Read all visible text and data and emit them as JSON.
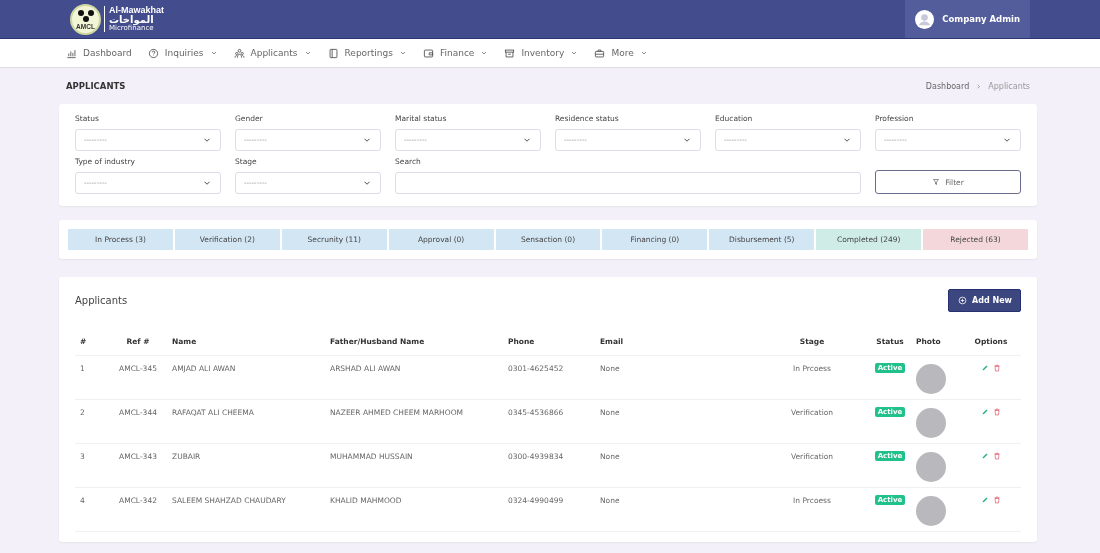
{
  "header": {
    "logo": {
      "title": "Al-Mawakhat",
      "arabic": "المواخات",
      "tagline": "Microfinance",
      "badge": "AMCL"
    },
    "user": "Company Admin"
  },
  "nav": [
    {
      "label": "Dashboard",
      "dropdown": false
    },
    {
      "label": "Inquiries",
      "dropdown": true
    },
    {
      "label": "Applicants",
      "dropdown": true
    },
    {
      "label": "Reportings",
      "dropdown": true
    },
    {
      "label": "Finance",
      "dropdown": true
    },
    {
      "label": "Inventory",
      "dropdown": true
    },
    {
      "label": "More",
      "dropdown": true
    }
  ],
  "page": {
    "title": "APPLICANTS",
    "breadcrumb": [
      "Dashboard",
      "Applicants"
    ]
  },
  "filters": [
    {
      "label": "Status",
      "kind": "select",
      "value": "---------"
    },
    {
      "label": "Gender",
      "kind": "select",
      "value": "---------"
    },
    {
      "label": "Marital status",
      "kind": "select",
      "value": "---------"
    },
    {
      "label": "Residence status",
      "kind": "select",
      "value": "---------"
    },
    {
      "label": "Education",
      "kind": "select",
      "value": "---------"
    },
    {
      "label": "Profession",
      "kind": "select",
      "value": "---------"
    },
    {
      "label": "Type of industry",
      "kind": "select",
      "value": "---------"
    },
    {
      "label": "Stage",
      "kind": "select",
      "value": "---------"
    },
    {
      "label": "Search",
      "kind": "text"
    }
  ],
  "filter_button": "Filter",
  "stages": [
    {
      "label": "In Process (3)",
      "color": "#d3e6f4"
    },
    {
      "label": "Verification (2)",
      "color": "#d3e6f4"
    },
    {
      "label": "Secrunity (11)",
      "color": "#d3e6f4"
    },
    {
      "label": "Approval (0)",
      "color": "#d3e6f4"
    },
    {
      "label": "Sensaction (0)",
      "color": "#d3e6f4"
    },
    {
      "label": "Financing (0)",
      "color": "#d3e6f4"
    },
    {
      "label": "Disbursement (5)",
      "color": "#d3e6f4"
    },
    {
      "label": "Completed (249)",
      "color": "#cfece6"
    },
    {
      "label": "Rejected (63)",
      "color": "#f3d7da"
    }
  ],
  "table": {
    "title": "Applicants",
    "add_button": "Add New",
    "columns": [
      "#",
      "Ref #",
      "Name",
      "Father/Husband Name",
      "Phone",
      "Email",
      "Stage",
      "Status",
      "Photo",
      "Options"
    ],
    "rows": [
      {
        "no": "1",
        "ref": "AMCL-345",
        "name": "AMJAD ALI AWAN",
        "father": "ARSHAD ALI AWAN",
        "phone": "0301-4625452",
        "email": "None",
        "stage": "In Prcoess",
        "status": "Active"
      },
      {
        "no": "2",
        "ref": "AMCL-344",
        "name": "RAFAQAT ALI CHEEMA",
        "father": "NAZEER AHMED CHEEM MARHOOM",
        "phone": "0345-4536866",
        "email": "None",
        "stage": "Verification",
        "status": "Active"
      },
      {
        "no": "3",
        "ref": "AMCL-343",
        "name": "ZUBAIR",
        "father": "MUHAMMAD HUSSAIN",
        "phone": "0300-4939834",
        "email": "None",
        "stage": "Verification",
        "status": "Active"
      },
      {
        "no": "4",
        "ref": "AMCL-342",
        "name": "SALEEM SHAHZAD CHAUDARY",
        "father": "KHALID MAHMOOD",
        "phone": "0324-4990499",
        "email": "None",
        "stage": "In Prcoess",
        "status": "Active"
      }
    ]
  }
}
